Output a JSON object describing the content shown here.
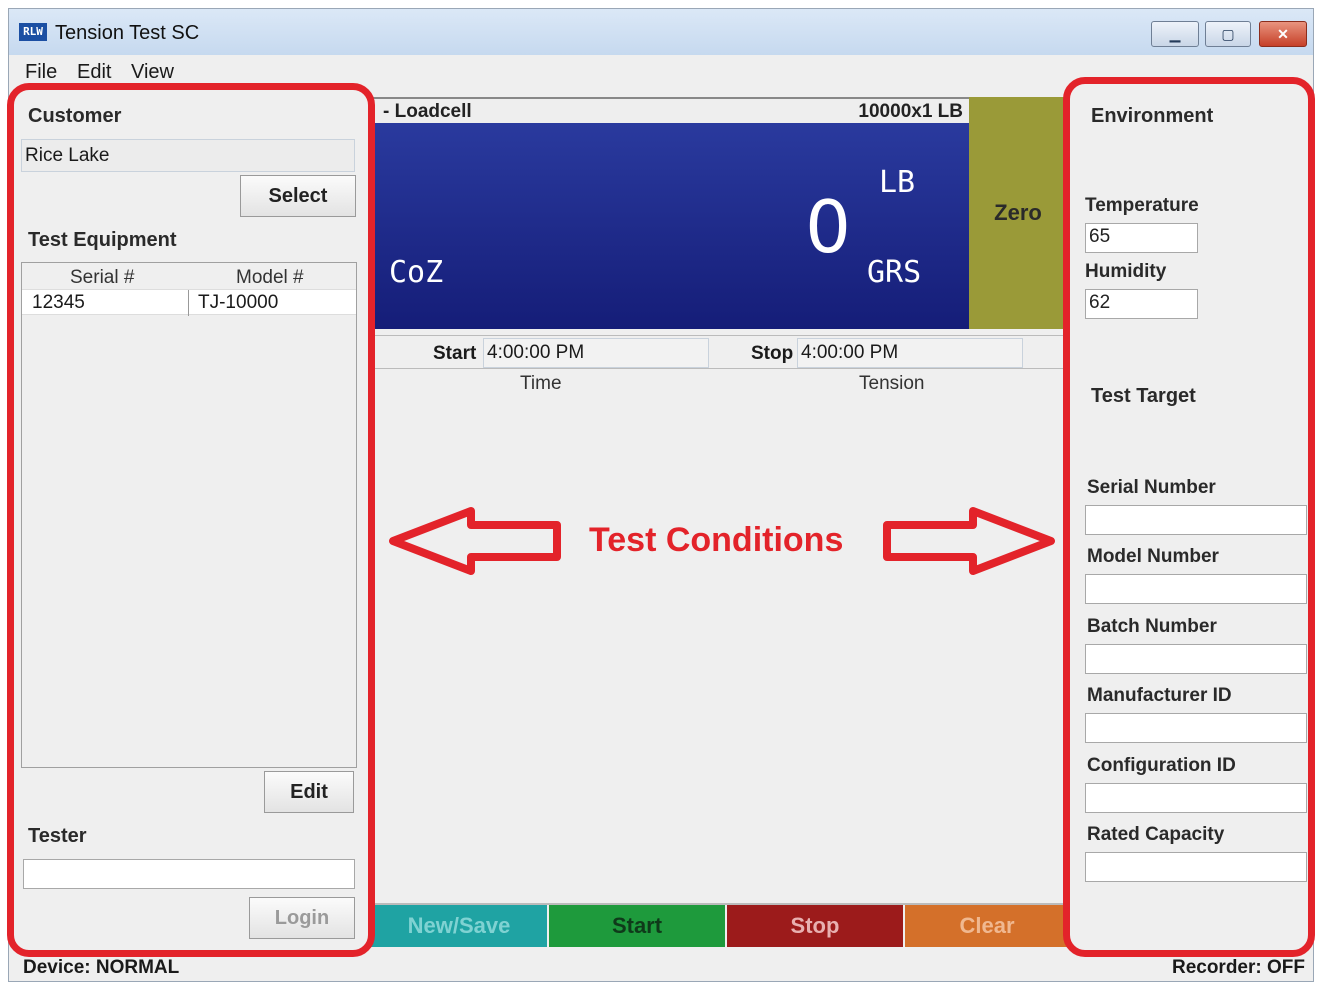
{
  "window": {
    "title": "Tension Test SC",
    "icon": "app-logo-icon"
  },
  "menu": [
    "File",
    "Edit",
    "View"
  ],
  "left": {
    "customer_title": "Customer",
    "customer_value": "Rice Lake",
    "select_label": "Select",
    "equipment_title": "Test Equipment",
    "columns": [
      "Serial #",
      "Model #"
    ],
    "rows": [
      {
        "serial": "12345",
        "model": "TJ-10000"
      }
    ],
    "edit_label": "Edit",
    "tester_title": "Tester",
    "tester_value": "",
    "login_label": "Login"
  },
  "center": {
    "scale_name": "- Loadcell",
    "capacity": "10000x1 LB",
    "weight": "0",
    "unit": "LB",
    "mode": "GRS",
    "coz": "CoZ",
    "zero_label": "Zero",
    "start_label": "Start",
    "start_time": "4:00:00 PM",
    "stop_label": "Stop",
    "stop_time": "4:00:00 PM",
    "col_time": "Time",
    "col_tension": "Tension",
    "annotation": "Test Conditions",
    "actions": {
      "new_save": "New/Save",
      "start": "Start",
      "stop": "Stop",
      "clear": "Clear"
    }
  },
  "right": {
    "environment_title": "Environment",
    "temperature_label": "Temperature",
    "temperature_value": "65",
    "humidity_label": "Humidity",
    "humidity_value": "62",
    "target_title": "Test Target",
    "serial_label": "Serial Number",
    "model_label": "Model Number",
    "batch_label": "Batch Number",
    "manufacturer_label": "Manufacturer ID",
    "configuration_label": "Configuration ID",
    "capacity_label": "Rated Capacity"
  },
  "status": {
    "device": "Device: NORMAL",
    "recorder": "Recorder: OFF"
  },
  "colors": {
    "display_bg": "#1d2a8c",
    "zero_bg": "#9a9a38",
    "new_save_bg": "#1fa3a3",
    "start_bg": "#1e9a3c",
    "stop_bg": "#9c1b1b",
    "clear_bg": "#d4702a",
    "annotation": "#e3232a"
  }
}
